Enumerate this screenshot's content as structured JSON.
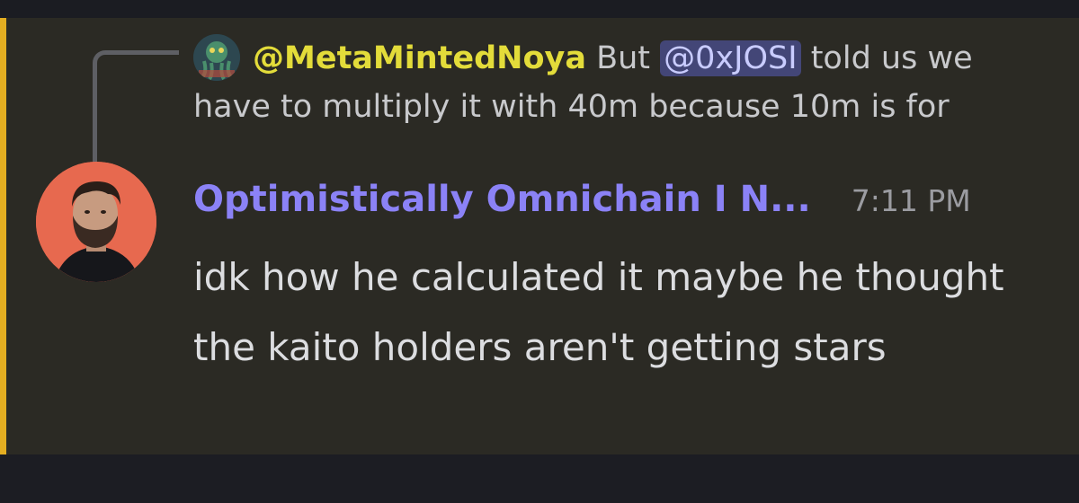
{
  "reply": {
    "author": "@MetaMintedNoya",
    "text_before": "But",
    "mention": "@0xJOSI",
    "text_after": "told us we have to multiply it with 40m because 10m is for"
  },
  "message": {
    "author": "Optimistically Omnichain I N...",
    "timestamp": "7:11 PM",
    "content": "idk how he calculated it maybe he thought the kaito holders aren't getting stars"
  },
  "colors": {
    "highlight_bar": "#e4ae21",
    "reply_author": "#e3dc3a",
    "author_name": "#8b82f6",
    "mention_bg": "#434677",
    "message_bg": "#2b2a24"
  },
  "icons": {
    "reply_avatar": "octopus-nft-avatar",
    "main_avatar": "bearded-man-avatar"
  }
}
